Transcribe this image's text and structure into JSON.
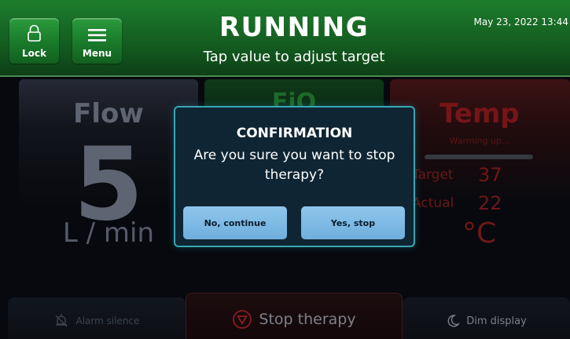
{
  "header": {
    "lock_label": "Lock",
    "menu_label": "Menu",
    "status": "RUNNING",
    "subtitle": "Tap value to adjust target",
    "datetime": "May 23, 2022 13:44"
  },
  "tiles": {
    "flow": {
      "title": "Flow",
      "value": "5",
      "unit": "L / min"
    },
    "fio2": {
      "title": "FiO"
    },
    "temp": {
      "title": "Temp",
      "status": "Warming up...",
      "target_label": "Target",
      "target_value": "37",
      "actual_label": "Actual",
      "actual_value": "22",
      "unit": "°C"
    }
  },
  "footer": {
    "alarm_label": "Alarm silence",
    "stop_label": "Stop therapy",
    "dim_label": "Dim display"
  },
  "modal": {
    "title": "CONFIRMATION",
    "message": "Are you sure you want to stop therapy?",
    "no_label": "No, continue",
    "yes_label": "Yes, stop"
  },
  "colors": {
    "header_green": "#1d7d2c",
    "modal_border": "#39a6b4",
    "modal_button": "#8ec6ec",
    "temp_red": "#751517"
  }
}
